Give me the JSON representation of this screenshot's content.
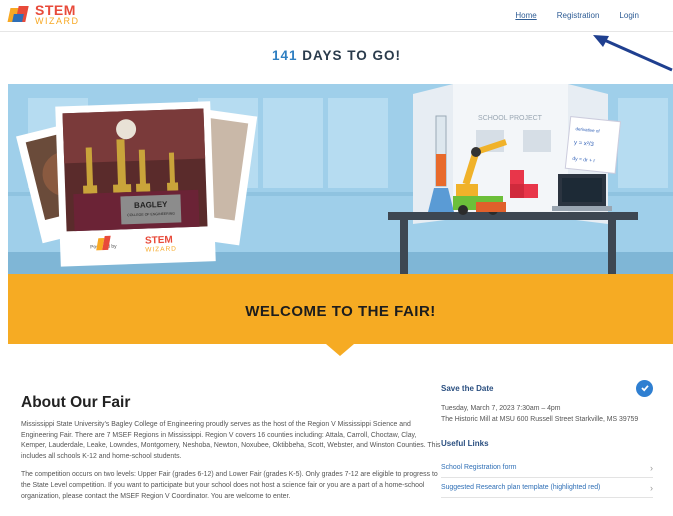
{
  "brand": {
    "line1": "STEM",
    "line2": "WIZARD"
  },
  "nav": {
    "items": [
      {
        "label": "Home"
      },
      {
        "label": "Registration"
      },
      {
        "label": "Login"
      }
    ]
  },
  "countdown": {
    "number": "141",
    "text": "DAYS TO GO!"
  },
  "hero": {
    "plaque_line1": "BAGLEY",
    "plaque_line2": "COLLEGE OF ENGINEERING",
    "powered_by": "Powered by",
    "board_title": "SCHOOL PROJECT",
    "note_line1": "derivative of",
    "note_line2": "y = x²/3",
    "note_line3": "dy = dr + r"
  },
  "welcome": {
    "title": "WELCOME TO THE FAIR!"
  },
  "about": {
    "title": "About Our Fair",
    "p1": "Mississippi State University’s Bagley College of Engineering proudly serves as the host of the Region V Mississippi Science and Engineering Fair. There are 7 MSEF Regions in Mississippi. Region V covers 16 counties including: Attala, Carroll, Choctaw, Clay, Kemper, Lauderdale, Leake, Lowndes, Montgomery, Neshoba, Newton, Noxubee, Oktibbeha, Scott, Webster, and Winston Counties. This includes all schools K-12 and home-school students.",
    "p2": "The competition occurs on two levels: Upper Fair (grades 6-12) and Lower Fair (grades K-5). Only grades 7-12 are eligible to progress to the State Level competition. If you want to participate but your school does not host a science fair or you are a part of a home-school organization, please contact the MSEF Region V Coordinator. You are welcome to enter."
  },
  "sidebar": {
    "save_title": "Save the Date",
    "save_line1": "Tuesday, March 7, 2023 7:30am – 4pm",
    "save_line2": "The Historic Mill at MSU 600 Russell Street Starkville, MS 39759",
    "links_title": "Useful Links",
    "links": [
      {
        "label": "School Registration form"
      },
      {
        "label": "Suggested Research plan template (highlighted red)"
      }
    ]
  },
  "colors": {
    "accent_orange": "#f6ab23",
    "link_blue": "#2f6fb6",
    "sky": "#a8d3ec",
    "brand_red": "#e84a3a"
  }
}
